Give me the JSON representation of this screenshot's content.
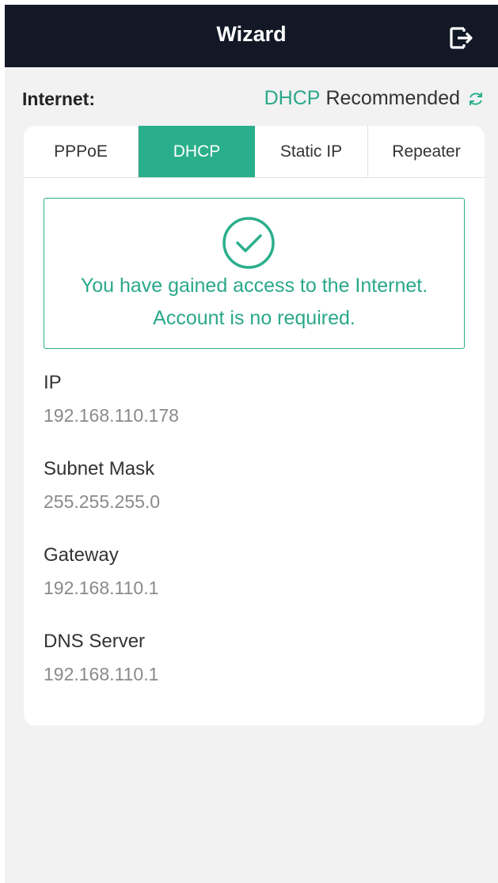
{
  "header": {
    "title": "Wizard",
    "logout_icon": "logout-icon"
  },
  "internet": {
    "label": "Internet:",
    "mode": "DHCP",
    "recommended": "Recommended",
    "refresh_icon": "refresh-icon"
  },
  "tabs": [
    {
      "label": "PPPoE",
      "active": false
    },
    {
      "label": "DHCP",
      "active": true
    },
    {
      "label": "Static IP",
      "active": false
    },
    {
      "label": "Repeater",
      "active": false
    }
  ],
  "status": {
    "icon": "check-circle-icon",
    "line1": "You have gained access to the Internet.",
    "line2": "Account is no required."
  },
  "fields": [
    {
      "label": "IP",
      "value": "192.168.110.178"
    },
    {
      "label": "Subnet Mask",
      "value": "255.255.255.0"
    },
    {
      "label": "Gateway",
      "value": "192.168.110.1"
    },
    {
      "label": "DNS Server",
      "value": "192.168.110.1"
    }
  ],
  "colors": {
    "header_bg": "#121826",
    "accent": "#2aaf8c",
    "page_bg": "#f2f2f2"
  }
}
